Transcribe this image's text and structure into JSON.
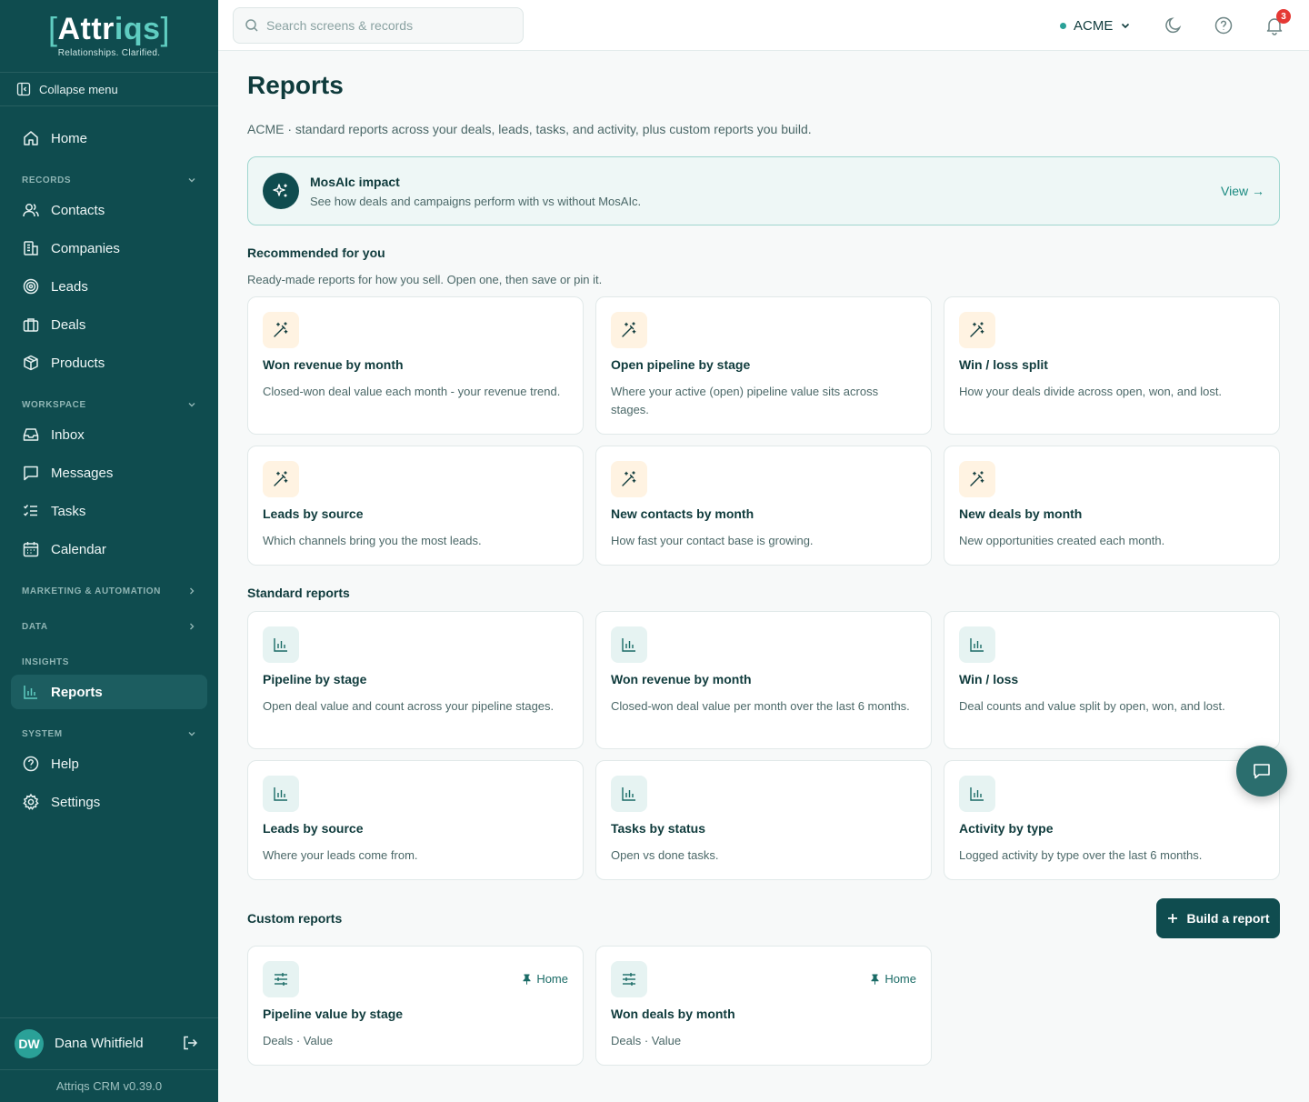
{
  "brand": {
    "open_bracket": "[",
    "logo_a": "Attr",
    "logo_b": "iqs",
    "close_bracket": "]",
    "tagline": "Relationships. Clarified."
  },
  "sidebar": {
    "collapse_label": "Collapse menu",
    "home": "Home",
    "sections": {
      "records": "RECORDS",
      "workspace": "WORKSPACE",
      "marketing": "MARKETING & AUTOMATION",
      "data": "DATA",
      "insights": "INSIGHTS",
      "system": "SYSTEM"
    },
    "items": {
      "contacts": "Contacts",
      "companies": "Companies",
      "leads": "Leads",
      "deals": "Deals",
      "products": "Products",
      "inbox": "Inbox",
      "messages": "Messages",
      "tasks": "Tasks",
      "calendar": "Calendar",
      "reports": "Reports",
      "help": "Help",
      "settings": "Settings"
    },
    "user": {
      "initials": "DW",
      "name": "Dana Whitfield"
    },
    "version": "Attriqs CRM v0.39.0"
  },
  "topbar": {
    "search_placeholder": "Search screens & records",
    "workspace": "ACME",
    "notification_count": "3"
  },
  "page": {
    "title": "Reports",
    "subtitle": "ACME · standard reports across your deals, leads, tasks, and activity, plus custom reports you build."
  },
  "banner": {
    "title": "MosAIc impact",
    "description": "See how deals and campaigns perform with vs without MosAIc.",
    "link": "View →"
  },
  "recommended": {
    "title": "Recommended for you",
    "subtitle": "Ready-made reports for how you sell. Open one, then save or pin it.",
    "cards": [
      {
        "title": "Won revenue by month",
        "desc": "Closed-won deal value each month - your revenue trend."
      },
      {
        "title": "Open pipeline by stage",
        "desc": "Where your active (open) pipeline value sits across stages."
      },
      {
        "title": "Win / loss split",
        "desc": "How your deals divide across open, won, and lost."
      },
      {
        "title": "Leads by source",
        "desc": "Which channels bring you the most leads."
      },
      {
        "title": "New contacts by month",
        "desc": "How fast your contact base is growing."
      },
      {
        "title": "New deals by month",
        "desc": "New opportunities created each month."
      }
    ]
  },
  "standard": {
    "title": "Standard reports",
    "cards": [
      {
        "title": "Pipeline by stage",
        "desc": "Open deal value and count across your pipeline stages."
      },
      {
        "title": "Won revenue by month",
        "desc": "Closed-won deal value per month over the last 6 months."
      },
      {
        "title": "Win / loss",
        "desc": "Deal counts and value split by open, won, and lost."
      },
      {
        "title": "Leads by source",
        "desc": "Where your leads come from."
      },
      {
        "title": "Tasks by status",
        "desc": "Open vs done tasks."
      },
      {
        "title": "Activity by type",
        "desc": "Logged activity by type over the last 6 months."
      }
    ]
  },
  "custom": {
    "title": "Custom reports",
    "build_label": "Build a report",
    "cards": [
      {
        "title": "Pipeline value by stage",
        "desc": "Deals · Value",
        "pin": "Home"
      },
      {
        "title": "Won deals by month",
        "desc": "Deals · Value",
        "pin": "Home"
      }
    ]
  },
  "colors": {
    "sidebar_bg": "#0f4c4f",
    "accent": "#2aa198",
    "link": "#1a8a80",
    "badge": "#e53935"
  },
  "icons": {
    "wand": "magic-wand-icon",
    "bars": "bar-chart-icon",
    "sliders": "sliders-icon",
    "pin": "pin-icon"
  }
}
